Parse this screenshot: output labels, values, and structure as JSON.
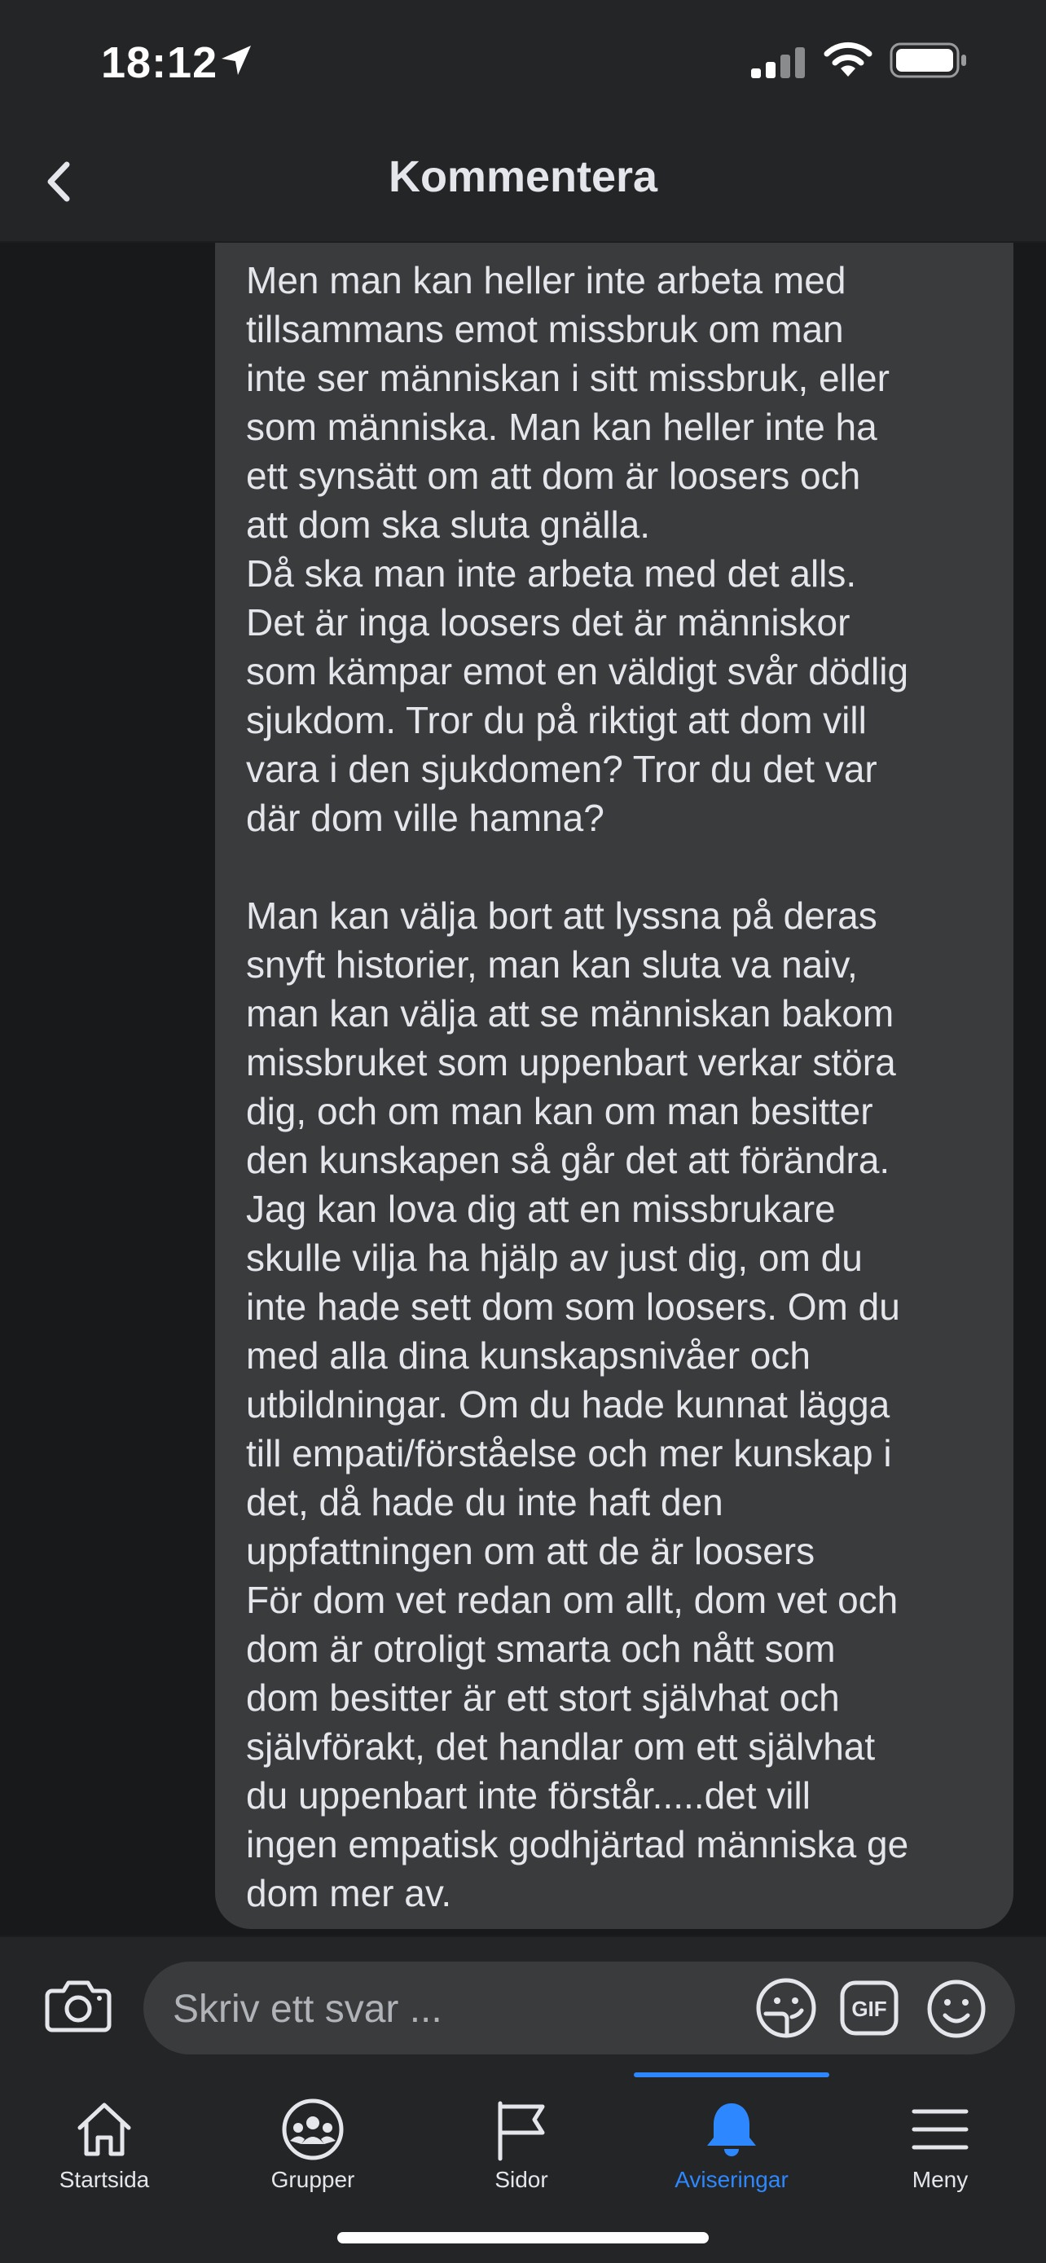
{
  "status_bar": {
    "time": "18:12"
  },
  "header": {
    "title": "Kommentera"
  },
  "comment": {
    "text": "Men man kan heller inte arbeta med\ntillsammans emot missbruk om man\ninte ser människan i sitt missbruk, eller\nsom människa. Man kan heller inte ha\nett synsätt om att dom är loosers och\natt dom ska sluta gnälla.\nDå ska man inte arbeta med det alls.\nDet är inga loosers det är människor\nsom kämpar emot en väldigt svår dödlig\nsjukdom. Tror du på riktigt att dom vill\nvara i den sjukdomen? Tror du det var\ndär dom ville hamna?\n\nMan kan välja bort att lyssna på deras\nsnyft historier, man kan sluta va naiv,\nman kan välja att se människan bakom\nmissbruket som uppenbart verkar störa\ndig, och om man kan om man besitter\nden kunskapen så går det att förändra.\nJag kan lova dig att en missbrukare\nskulle vilja ha hjälp av just dig, om du\ninte hade sett dom som loosers. Om du\nmed alla dina kunskapsnivåer och\nutbildningar. Om du hade kunnat lägga\ntill empati/förståelse och mer kunskap i\ndet, då hade du inte haft den\nuppfattningen om att de är loosers\nFör dom vet redan om allt, dom vet och\ndom är otroligt smarta och nått som\ndom besitter är ett stort självhat och\nsjälvförakt, det handlar om ett självhat\ndu uppenbart inte förstår.....det vill\ningen empatisk godhjärtad människa ge\ndom mer av."
  },
  "reply": {
    "placeholder": "Skriv ett svar ...",
    "value": ""
  },
  "tabs": [
    {
      "label": "Startsida",
      "icon": "home-icon",
      "active": false
    },
    {
      "label": "Grupper",
      "icon": "groups-icon",
      "active": false
    },
    {
      "label": "Sidor",
      "icon": "flag-icon",
      "active": false
    },
    {
      "label": "Aviseringar",
      "icon": "bell-icon",
      "active": true
    },
    {
      "label": "Meny",
      "icon": "hamburger-menu-icon",
      "active": false
    }
  ],
  "colors": {
    "background": "#242526",
    "feed_background": "#18191a",
    "bubble": "#3a3b3c",
    "text": "#e4e6eb",
    "accent": "#2d88ff"
  }
}
